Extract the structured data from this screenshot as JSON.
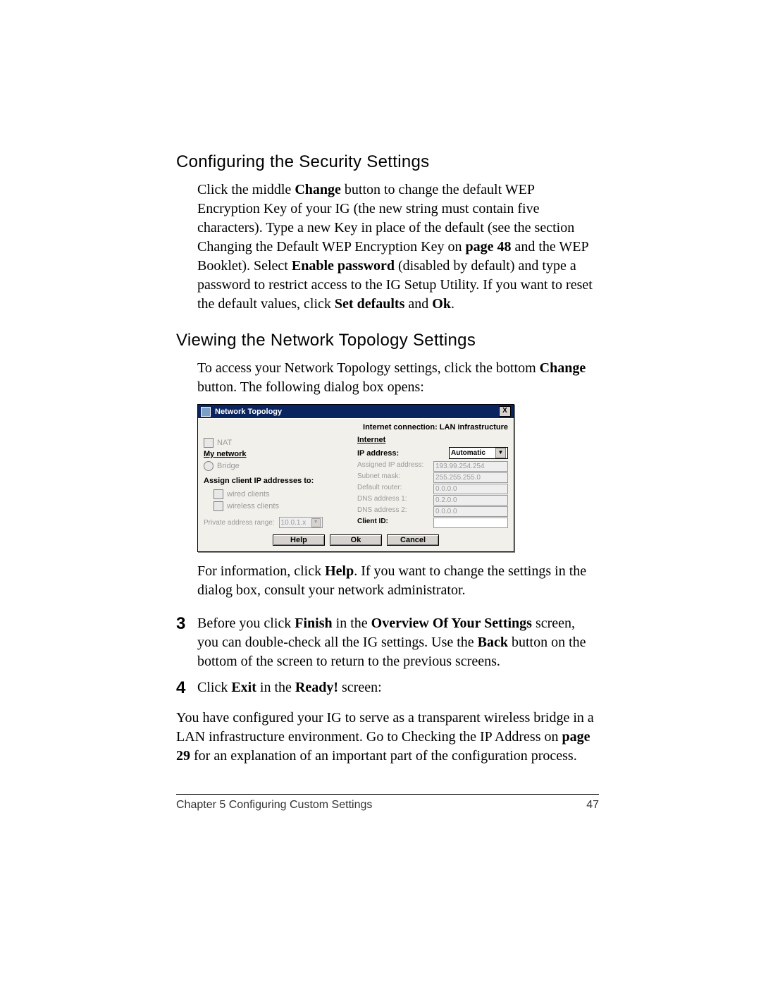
{
  "sections": {
    "security": {
      "heading": "Configuring the Security Settings",
      "p1_a": "Click the middle ",
      "p1_change": "Change",
      "p1_b": " button to change the default WEP Encryption Key of your IG (the new string must contain five characters). Type a new Key in place of the default (see the section Changing the Default WEP Encryption Key on ",
      "p1_pageref": "page 48",
      "p1_c": " and the WEP Booklet). Select ",
      "p1_enablepw": "Enable password",
      "p1_d": " (disabled by default) and type a password to restrict access to the IG Setup Utility. If you want to reset the default values, click ",
      "p1_setdefaults": "Set defaults",
      "p1_and": " and ",
      "p1_ok": "Ok",
      "p1_dot": "."
    },
    "topology": {
      "heading": "Viewing the Network Topology Settings",
      "p1_a": "To access your Network Topology settings, click the bottom ",
      "p1_change": "Change",
      "p1_b": " button. The following dialog box opens:",
      "p2_a": "For information, click ",
      "p2_help": "Help",
      "p2_b": ". If you want to change the settings in the dialog box, consult your network administrator."
    },
    "step3": {
      "num": "3",
      "a": "Before you click ",
      "finish": "Finish",
      "b": " in the ",
      "overview": "Overview Of Your Settings",
      "c": " screen, you can double-check all the IG settings. Use the ",
      "back": "Back",
      "d": " button on the bottom of the screen to return to the previous screens."
    },
    "step4": {
      "num": "4",
      "a": "Click ",
      "exit": "Exit",
      "b": " in the ",
      "ready": "Ready!",
      "c": " screen:"
    },
    "closing": {
      "a": "You have configured your IG to serve as a transparent wireless bridge in a LAN infrastructure environment. Go to Checking the IP Address on ",
      "pageref": "page 29",
      "b": " for an explanation of an important part of the configuration process."
    }
  },
  "dialog": {
    "title": "Network Topology",
    "close": "X",
    "connection_label": "Internet connection: LAN infrastructure",
    "left": {
      "nat": "NAT",
      "mynet_head": "My network",
      "bridge": "Bridge",
      "assign_label": "Assign client IP addresses to:",
      "wired": "wired clients",
      "wireless": "wireless clients",
      "par_label": "Private address range:",
      "par_value": "10.0.1.x"
    },
    "right": {
      "internet_head": "Internet",
      "ip_label": "IP address:",
      "ip_mode": "Automatic",
      "rows": {
        "assigned_ip": {
          "k": "Assigned IP address:",
          "v": "193.99.254.254"
        },
        "subnet": {
          "k": "Subnet mask:",
          "v": "255.255.255.0"
        },
        "router": {
          "k": "Default router:",
          "v": "0.0.0.0"
        },
        "dns1": {
          "k": "DNS address 1:",
          "v": "0.2.0.0"
        },
        "dns2": {
          "k": "DNS address 2:",
          "v": "0.0.0.0"
        },
        "client": {
          "k": "Client ID:",
          "v": ""
        }
      }
    },
    "buttons": {
      "help": "Help",
      "ok": "Ok",
      "cancel": "Cancel"
    }
  },
  "footer": {
    "chapter": "Chapter 5    Configuring Custom Settings",
    "page": "47"
  }
}
